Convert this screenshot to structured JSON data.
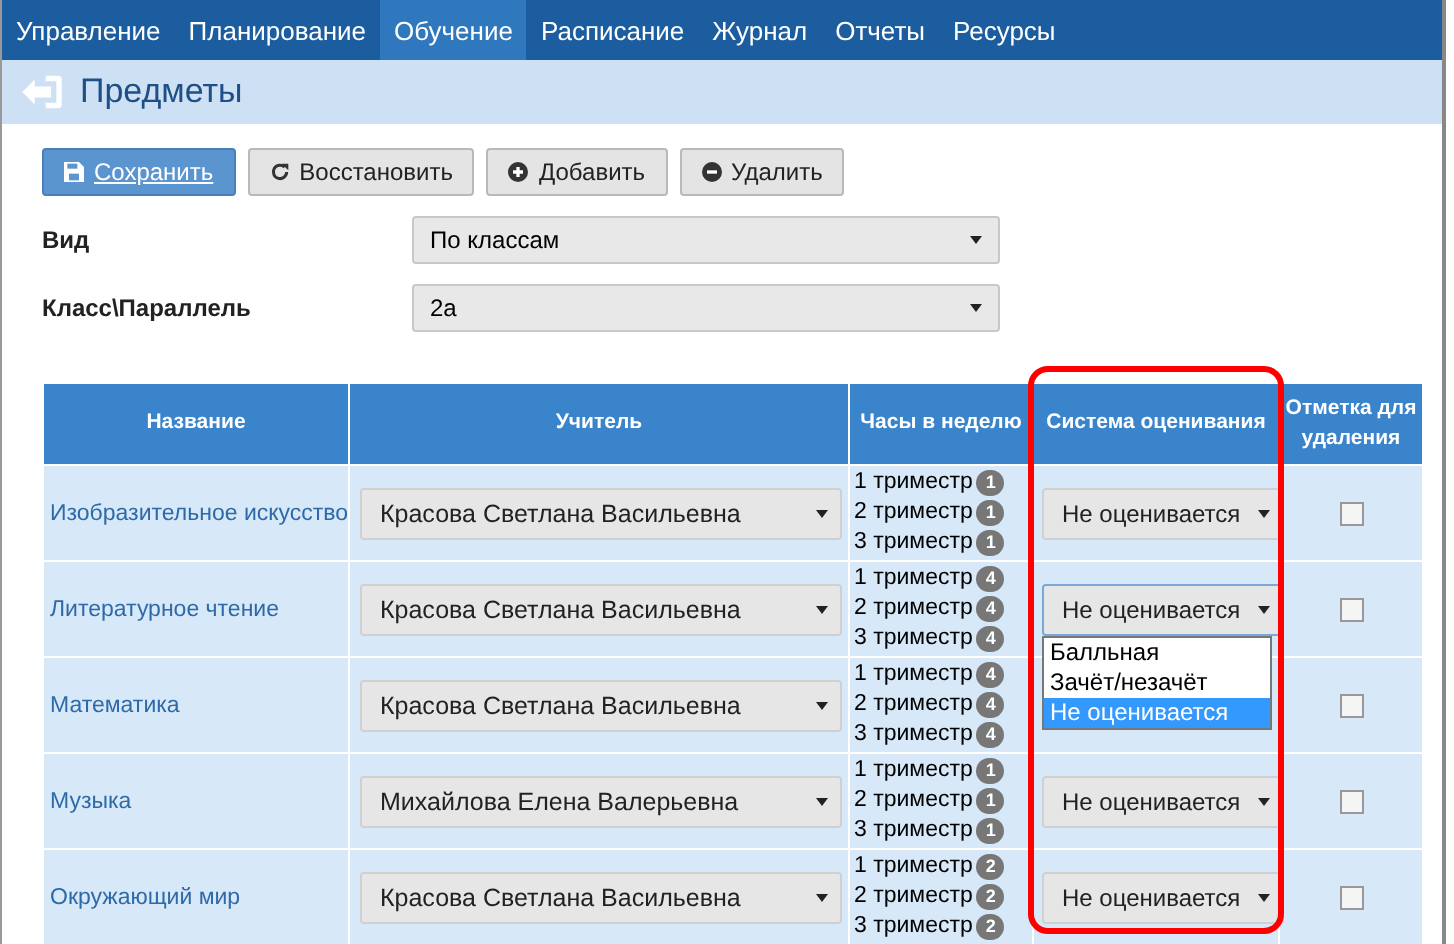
{
  "nav": [
    {
      "label": "Управление",
      "selected": false
    },
    {
      "label": "Планирование",
      "selected": false
    },
    {
      "label": "Обучение",
      "selected": true
    },
    {
      "label": "Расписание",
      "selected": false
    },
    {
      "label": "Журнал",
      "selected": false
    },
    {
      "label": "Отчеты",
      "selected": false
    },
    {
      "label": "Ресурсы",
      "selected": false
    }
  ],
  "page_title": "Предметы",
  "toolbar": [
    {
      "label": "Сохранить",
      "kind": "save",
      "primary": true
    },
    {
      "label": "Восстановить",
      "kind": "restore",
      "primary": false
    },
    {
      "label": "Добавить",
      "kind": "add",
      "primary": false
    },
    {
      "label": "Удалить",
      "kind": "delete",
      "primary": false
    }
  ],
  "filters": [
    {
      "label": "Вид",
      "value": "По классам"
    },
    {
      "label": "Класс\\Параллель",
      "value": "2а"
    }
  ],
  "table": {
    "columns": [
      {
        "label": "Название",
        "highlighted": false
      },
      {
        "label": "Учитель",
        "highlighted": false
      },
      {
        "label": "Часы в неделю",
        "highlighted": false
      },
      {
        "label": "Система оценивания",
        "highlighted": true
      },
      {
        "label": "Отметка для удаления",
        "highlighted": false
      }
    ],
    "rows": [
      {
        "name": "Изобразительное искусство",
        "teacher": "Красова Светлана Васильевна",
        "hours": [
          {
            "term": "1 триместр",
            "count": "1"
          },
          {
            "term": "2 триместр",
            "count": "1"
          },
          {
            "term": "3 триместр",
            "count": "1"
          }
        ],
        "grading": "Не оценивается",
        "open": false,
        "marked": false
      },
      {
        "name": "Литературное чтение",
        "teacher": "Красова Светлана Васильевна",
        "hours": [
          {
            "term": "1 триместр",
            "count": "4"
          },
          {
            "term": "2 триместр",
            "count": "4"
          },
          {
            "term": "3 триместр",
            "count": "4"
          }
        ],
        "grading": "Не оценивается",
        "open": true,
        "options": [
          {
            "label": "Балльная",
            "selected": false
          },
          {
            "label": "Зачёт/незачёт",
            "selected": false
          },
          {
            "label": "Не оценивается",
            "selected": true
          }
        ],
        "marked": false
      },
      {
        "name": "Математика",
        "teacher": "Красова Светлана Васильевна",
        "hours": [
          {
            "term": "1 триместр",
            "count": "4"
          },
          {
            "term": "2 триместр",
            "count": "4"
          },
          {
            "term": "3 триместр",
            "count": "4"
          }
        ],
        "marked": false
      },
      {
        "name": "Музыка",
        "teacher": "Михайлова Елена Валерьевна",
        "hours": [
          {
            "term": "1 триместр",
            "count": "1"
          },
          {
            "term": "2 триместр",
            "count": "1"
          },
          {
            "term": "3 триместр",
            "count": "1"
          }
        ],
        "grading": "Не оценивается",
        "open": false,
        "marked": false
      },
      {
        "name": "Окружающий мир",
        "teacher": "Красова Светлана Васильевна",
        "hours": [
          {
            "term": "1 триместр",
            "count": "2"
          },
          {
            "term": "2 триместр",
            "count": "2"
          },
          {
            "term": "3 триместр",
            "count": "2"
          }
        ],
        "grading": "Не оценивается",
        "open": false,
        "marked": false
      }
    ]
  }
}
